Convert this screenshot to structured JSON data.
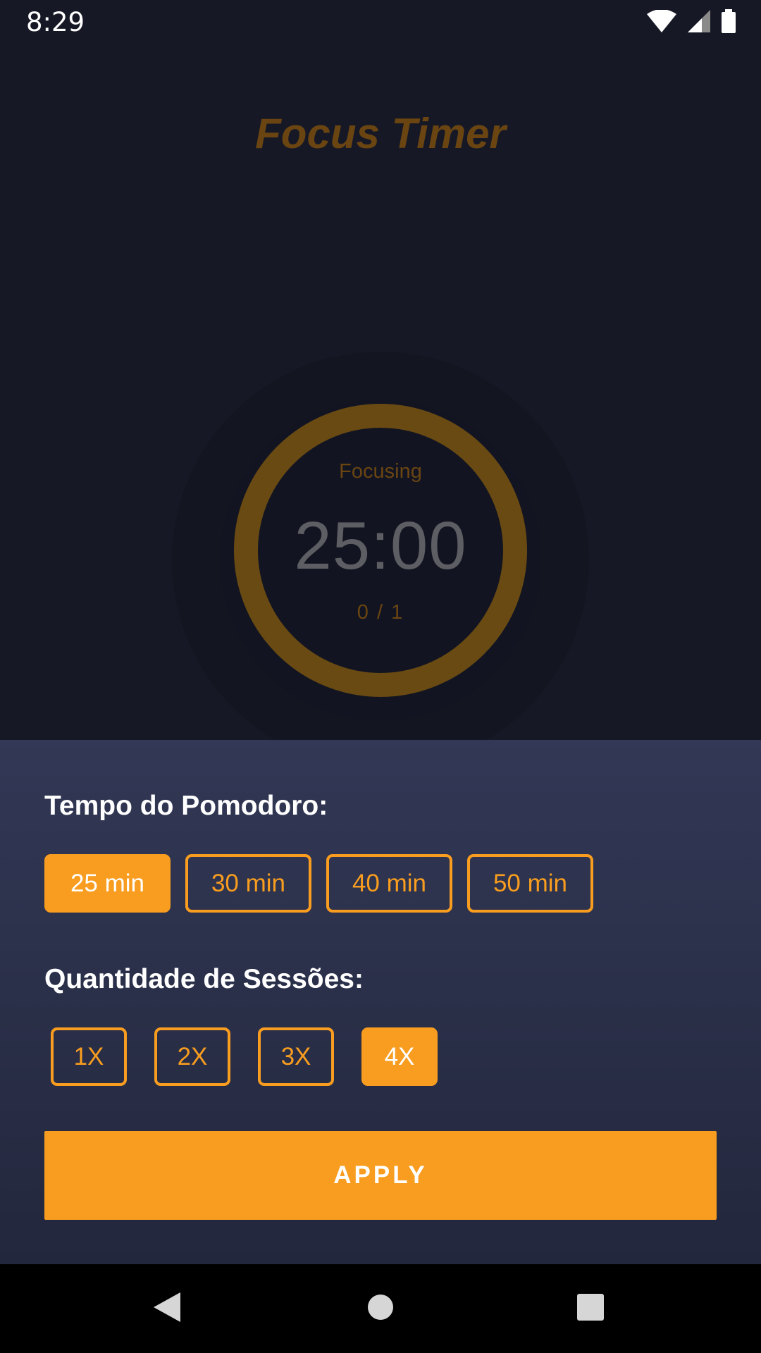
{
  "status_bar": {
    "time": "8:29",
    "icons": [
      "wifi-icon",
      "cellular-signal-icon",
      "battery-icon"
    ]
  },
  "app": {
    "title": "Focus Timer"
  },
  "timer": {
    "status": "Focusing",
    "time": "25:00",
    "sessions": "0 / 1",
    "progress": 0
  },
  "settings": {
    "pomodoro_heading": "Tempo do Pomodoro:",
    "time_options": [
      {
        "label": "25 min",
        "selected": true
      },
      {
        "label": "30 min",
        "selected": false
      },
      {
        "label": "40 min",
        "selected": false
      },
      {
        "label": "50 min",
        "selected": false
      }
    ],
    "sessions_heading": "Quantidade de Sessões:",
    "session_options": [
      {
        "label": "1X",
        "selected": false
      },
      {
        "label": "2X",
        "selected": false
      },
      {
        "label": "3X",
        "selected": false
      },
      {
        "label": "4X",
        "selected": true
      }
    ],
    "apply_label": "APPLY"
  },
  "nav": {
    "icons": [
      "back-icon",
      "home-icon",
      "recents-icon"
    ]
  },
  "colors": {
    "accent": "#f89d1f",
    "background": "#161925",
    "sheet": "#2c3250"
  }
}
